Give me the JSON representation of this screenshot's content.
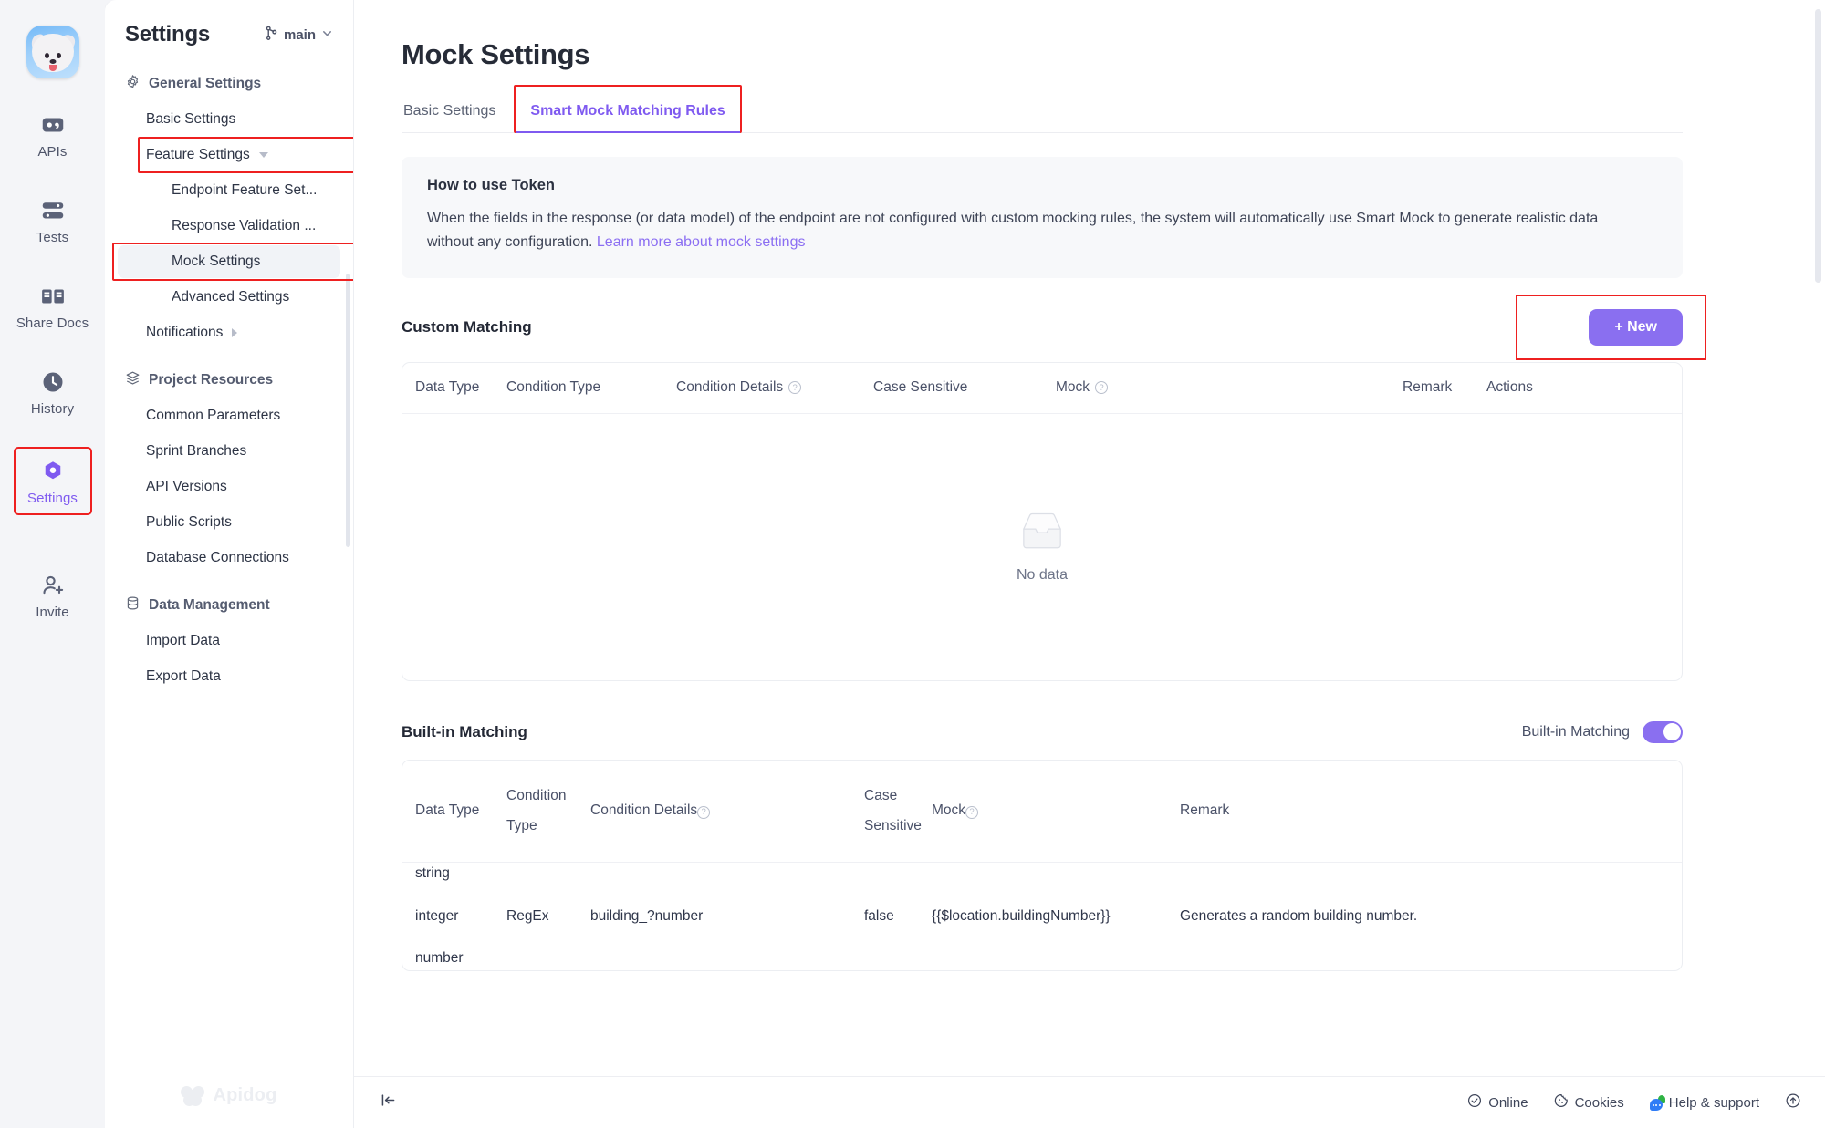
{
  "rail": {
    "avatar_name": "project-avatar",
    "items": [
      {
        "label": "APIs",
        "icon": "apis-icon",
        "active": false
      },
      {
        "label": "Tests",
        "icon": "tests-icon",
        "active": false
      },
      {
        "label": "Share Docs",
        "icon": "share-docs-icon",
        "active": false
      },
      {
        "label": "History",
        "icon": "history-icon",
        "active": false
      },
      {
        "label": "Settings",
        "icon": "settings-icon",
        "active": true
      },
      {
        "label": "Invite",
        "icon": "invite-icon",
        "active": false
      }
    ]
  },
  "settings_panel": {
    "title": "Settings",
    "branch": "main",
    "groups": [
      {
        "label": "General Settings",
        "icon": "gear-icon",
        "items": [
          {
            "label": "Basic Settings",
            "level": 1
          },
          {
            "label": "Feature Settings",
            "level": 1,
            "caret": "down"
          },
          {
            "label": "Endpoint Feature Set...",
            "level": 2
          },
          {
            "label": "Response Validation ...",
            "level": 2
          },
          {
            "label": "Mock Settings",
            "level": 2,
            "selected": true
          },
          {
            "label": "Advanced Settings",
            "level": 2
          },
          {
            "label": "Notifications",
            "level": 1,
            "caret": "right"
          }
        ]
      },
      {
        "label": "Project Resources",
        "icon": "layers-icon",
        "items": [
          {
            "label": "Common Parameters",
            "level": 1
          },
          {
            "label": "Sprint Branches",
            "level": 1
          },
          {
            "label": "API Versions",
            "level": 1
          },
          {
            "label": "Public Scripts",
            "level": 1
          },
          {
            "label": "Database Connections",
            "level": 1
          }
        ]
      },
      {
        "label": "Data Management",
        "icon": "database-icon",
        "items": [
          {
            "label": "Import Data",
            "level": 1
          },
          {
            "label": "Export Data",
            "level": 1
          }
        ]
      }
    ],
    "watermark": "Apidog"
  },
  "main": {
    "page_title": "Mock Settings",
    "tabs": [
      {
        "label": "Basic Settings",
        "active": false
      },
      {
        "label": "Smart Mock Matching Rules",
        "active": true
      }
    ],
    "notice": {
      "title": "How to use Token",
      "body": "When the fields in the response (or data model) of the endpoint are not configured with custom mocking rules, the system will automatically use Smart Mock to generate realistic data without any configuration.",
      "link": "Learn more about mock settings"
    },
    "custom_matching": {
      "title": "Custom Matching",
      "new_button": "+ New",
      "columns": [
        "Data Type",
        "Condition Type",
        "Condition Details",
        "Case Sensitive",
        "Mock",
        "Remark",
        "Actions"
      ],
      "empty_text": "No data",
      "rows": []
    },
    "builtin_matching": {
      "title": "Built-in Matching",
      "toggle_label": "Built-in Matching",
      "toggle_on": true,
      "columns": [
        "Data Type",
        "Condition Type",
        "Condition Details",
        "Case Sensitive",
        "Mock",
        "Remark"
      ],
      "rows": [
        {
          "data_type": [
            "string",
            "integer",
            "number"
          ],
          "condition_type": "RegEx",
          "condition_details": "building_?number",
          "case_sensitive": "false",
          "mock": "{{$location.buildingNumber}}",
          "remark": "Generates a random building number."
        }
      ]
    }
  },
  "footer": {
    "collapse_icon": "collapse-left-icon",
    "items": [
      {
        "label": "Online",
        "icon": "check-circle-icon"
      },
      {
        "label": "Cookies",
        "icon": "cookie-icon"
      },
      {
        "label": "Help & support",
        "icon": "chat-support-icon"
      }
    ],
    "scroll_top_icon": "arrow-up-circle-icon"
  },
  "colors": {
    "accent": "#8a6ff0",
    "highlight_box": "#ee2020",
    "toggle_on": "#8a6ff0"
  }
}
